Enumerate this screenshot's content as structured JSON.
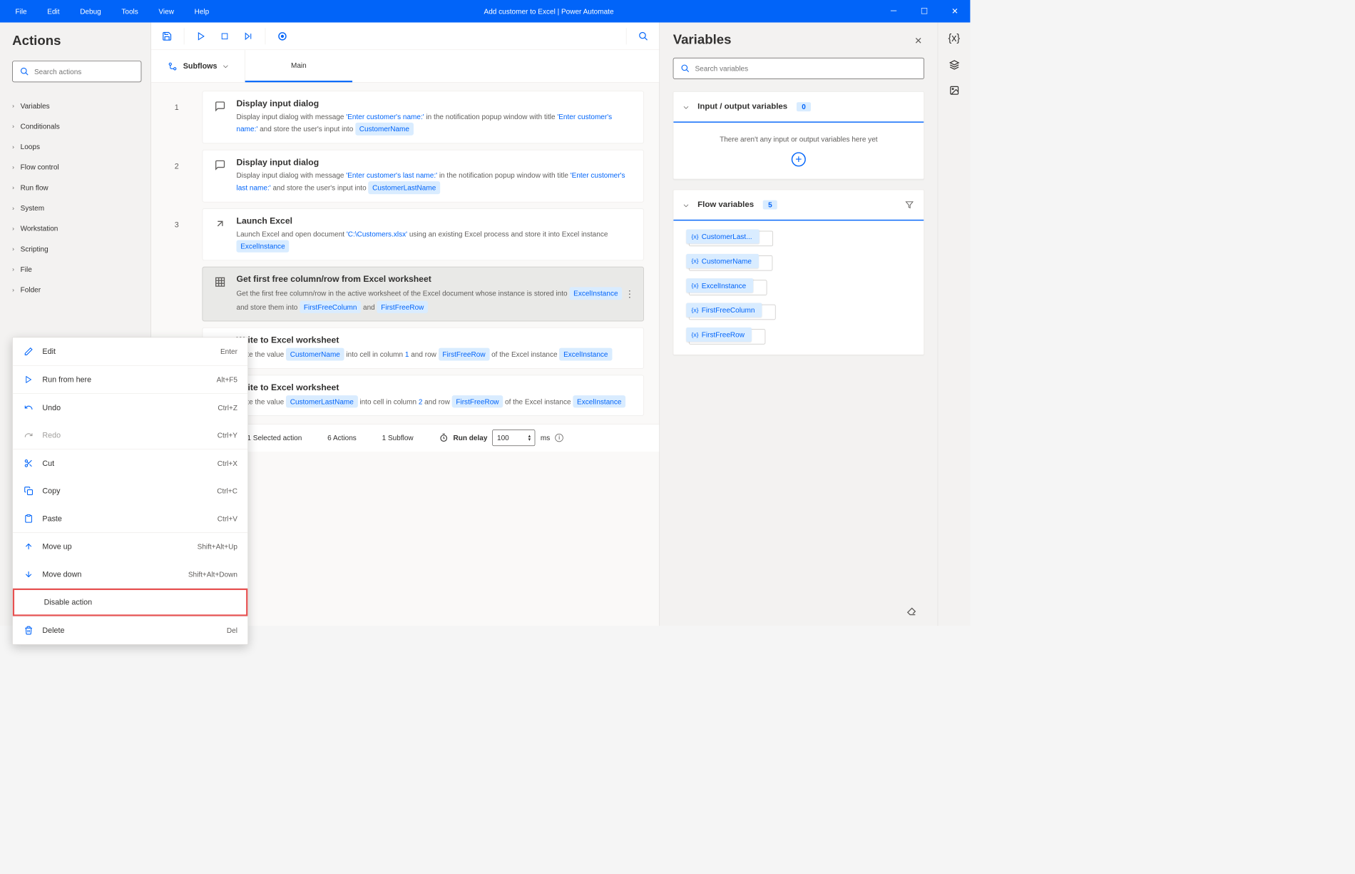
{
  "titlebar": {
    "menus": [
      "File",
      "Edit",
      "Debug",
      "Tools",
      "View",
      "Help"
    ],
    "title": "Add customer to Excel | Power Automate"
  },
  "actions": {
    "heading": "Actions",
    "search_placeholder": "Search actions",
    "categories": [
      "Variables",
      "Conditionals",
      "Loops",
      "Flow control",
      "Run flow",
      "System",
      "Workstation",
      "Scripting",
      "File",
      "Folder"
    ]
  },
  "context_menu": {
    "items": [
      {
        "icon": "pencil",
        "label": "Edit",
        "shortcut": "Enter",
        "disabled": false
      },
      {
        "sep": true
      },
      {
        "icon": "play",
        "label": "Run from here",
        "shortcut": "Alt+F5",
        "disabled": false
      },
      {
        "sep": true
      },
      {
        "icon": "undo",
        "label": "Undo",
        "shortcut": "Ctrl+Z",
        "disabled": false
      },
      {
        "icon": "redo",
        "label": "Redo",
        "shortcut": "Ctrl+Y",
        "disabled": true
      },
      {
        "sep": true
      },
      {
        "icon": "cut",
        "label": "Cut",
        "shortcut": "Ctrl+X",
        "disabled": false
      },
      {
        "icon": "copy",
        "label": "Copy",
        "shortcut": "Ctrl+C",
        "disabled": false
      },
      {
        "icon": "paste",
        "label": "Paste",
        "shortcut": "Ctrl+V",
        "disabled": false
      },
      {
        "sep": true
      },
      {
        "icon": "up",
        "label": "Move up",
        "shortcut": "Shift+Alt+Up",
        "disabled": false
      },
      {
        "icon": "down",
        "label": "Move down",
        "shortcut": "Shift+Alt+Down",
        "disabled": false
      },
      {
        "sep": true
      },
      {
        "icon": "",
        "label": "Disable action",
        "shortcut": "",
        "disabled": false,
        "highlight": true
      },
      {
        "sep": true
      },
      {
        "icon": "trash",
        "label": "Delete",
        "shortcut": "Del",
        "disabled": false
      }
    ]
  },
  "subflows_label": "Subflows",
  "tab_main": "Main",
  "steps": [
    {
      "num": "1",
      "icon": "dialog",
      "title": "Display input dialog",
      "body_parts": [
        "Display input dialog with message ",
        {
          "q": "'Enter customer's name:'"
        },
        " in the notification popup window with title ",
        {
          "q": "'Enter customer's name:'"
        },
        " and store the user's input into ",
        {
          "v": "CustomerName"
        }
      ]
    },
    {
      "num": "2",
      "icon": "dialog",
      "title": "Display input dialog",
      "body_parts": [
        "Display input dialog with message ",
        {
          "q": "'Enter customer's last name:'"
        },
        " in the notification popup window with title ",
        {
          "q": "'Enter customer's last name:'"
        },
        " and store the user's input into ",
        {
          "v": "CustomerLastName"
        }
      ]
    },
    {
      "num": "3",
      "icon": "launch",
      "title": "Launch Excel",
      "body_parts": [
        "Launch Excel and open document ",
        {
          "q": "'C:\\Customers.xlsx'"
        },
        " using an existing Excel process and store it into Excel instance ",
        {
          "v": "ExcelInstance"
        }
      ]
    },
    {
      "num": "",
      "icon": "grid",
      "selected": true,
      "title": "Get first free column/row from Excel worksheet",
      "body_parts": [
        "Get the first free column/row in the active worksheet of the Excel document whose instance is stored into ",
        {
          "v": "ExcelInstance"
        },
        " and store them into ",
        {
          "v": "FirstFreeColumn"
        },
        " and ",
        {
          "v": "FirstFreeRow"
        }
      ]
    },
    {
      "num": "",
      "icon": "grid",
      "title": "Write to Excel worksheet",
      "body_parts": [
        "Write the value ",
        {
          "v": "CustomerName"
        },
        " into cell in column ",
        {
          "q": "1"
        },
        " and row ",
        {
          "v": "FirstFreeRow"
        },
        " of the Excel instance ",
        {
          "v": "ExcelInstance"
        }
      ]
    },
    {
      "num": "",
      "icon": "grid",
      "title": "Write to Excel worksheet",
      "body_parts": [
        "Write the value ",
        {
          "v": "CustomerLastName"
        },
        " into cell in column ",
        {
          "q": "2"
        },
        " and row ",
        {
          "v": "FirstFreeRow"
        },
        " of the Excel instance ",
        {
          "v": "ExcelInstance"
        }
      ]
    }
  ],
  "status": {
    "selected": "1 Selected action",
    "actions": "6 Actions",
    "subflows": "1 Subflow",
    "delay_label": "Run delay",
    "delay_value": "100",
    "delay_unit": "ms"
  },
  "variables": {
    "heading": "Variables",
    "search_placeholder": "Search variables",
    "io_title": "Input / output variables",
    "io_count": "0",
    "io_empty": "There aren't any input or output variables here yet",
    "flow_title": "Flow variables",
    "flow_count": "5",
    "chips": [
      "CustomerLast...",
      "CustomerName",
      "ExcelInstance",
      "FirstFreeColumn",
      "FirstFreeRow"
    ]
  }
}
